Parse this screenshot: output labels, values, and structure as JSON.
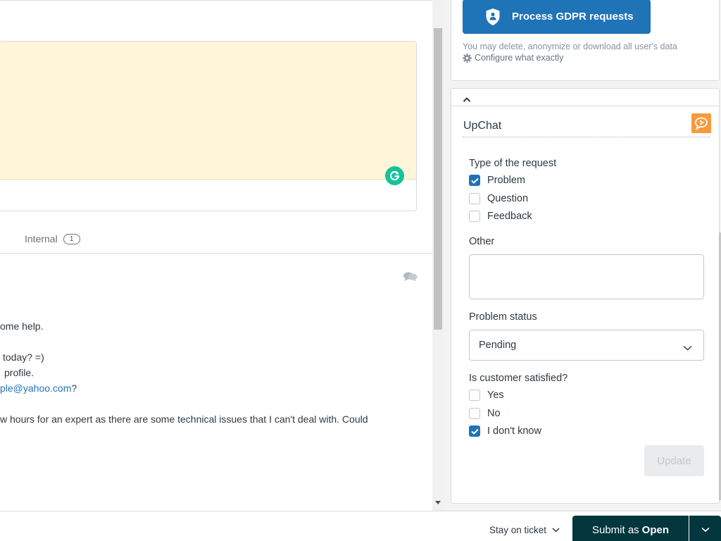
{
  "editor": {
    "internal_tab_label": "Internal",
    "internal_count": "1"
  },
  "conversation": {
    "lines": [
      "ome help.",
      "today? =)",
      "profile.",
      "ple@yahoo.com",
      "?",
      "w hours for an expert as there are some technical issues that I can't deal with. Could"
    ]
  },
  "gdpr": {
    "button_label": "Process GDPR requests",
    "hint": "You may delete, anonymize or download all user's data",
    "configure_label": "Configure what exactly"
  },
  "upchat": {
    "title": "UpChat",
    "request_type_label": "Type of the request",
    "request_options": [
      {
        "label": "Problem",
        "checked": true
      },
      {
        "label": "Question",
        "checked": false
      },
      {
        "label": "Feedback",
        "checked": false
      }
    ],
    "other_label": "Other",
    "other_value": "",
    "problem_status_label": "Problem status",
    "problem_status_value": "Pending",
    "satisfied_label": "Is customer satisfied?",
    "satisfied_options": [
      {
        "label": "Yes",
        "checked": false
      },
      {
        "label": "No",
        "checked": false
      },
      {
        "label": "I don't know",
        "checked": true
      }
    ],
    "update_label": "Update"
  },
  "footer": {
    "stay_label": "Stay on ticket",
    "submit_prefix": "Submit as",
    "submit_status": "Open"
  },
  "colors": {
    "primary": "#1f73b7",
    "submit_bg": "#03363d",
    "editor_bg": "#fff5d9",
    "grammarly": "#15c39a",
    "upchat_logo": "#f79a3e"
  }
}
